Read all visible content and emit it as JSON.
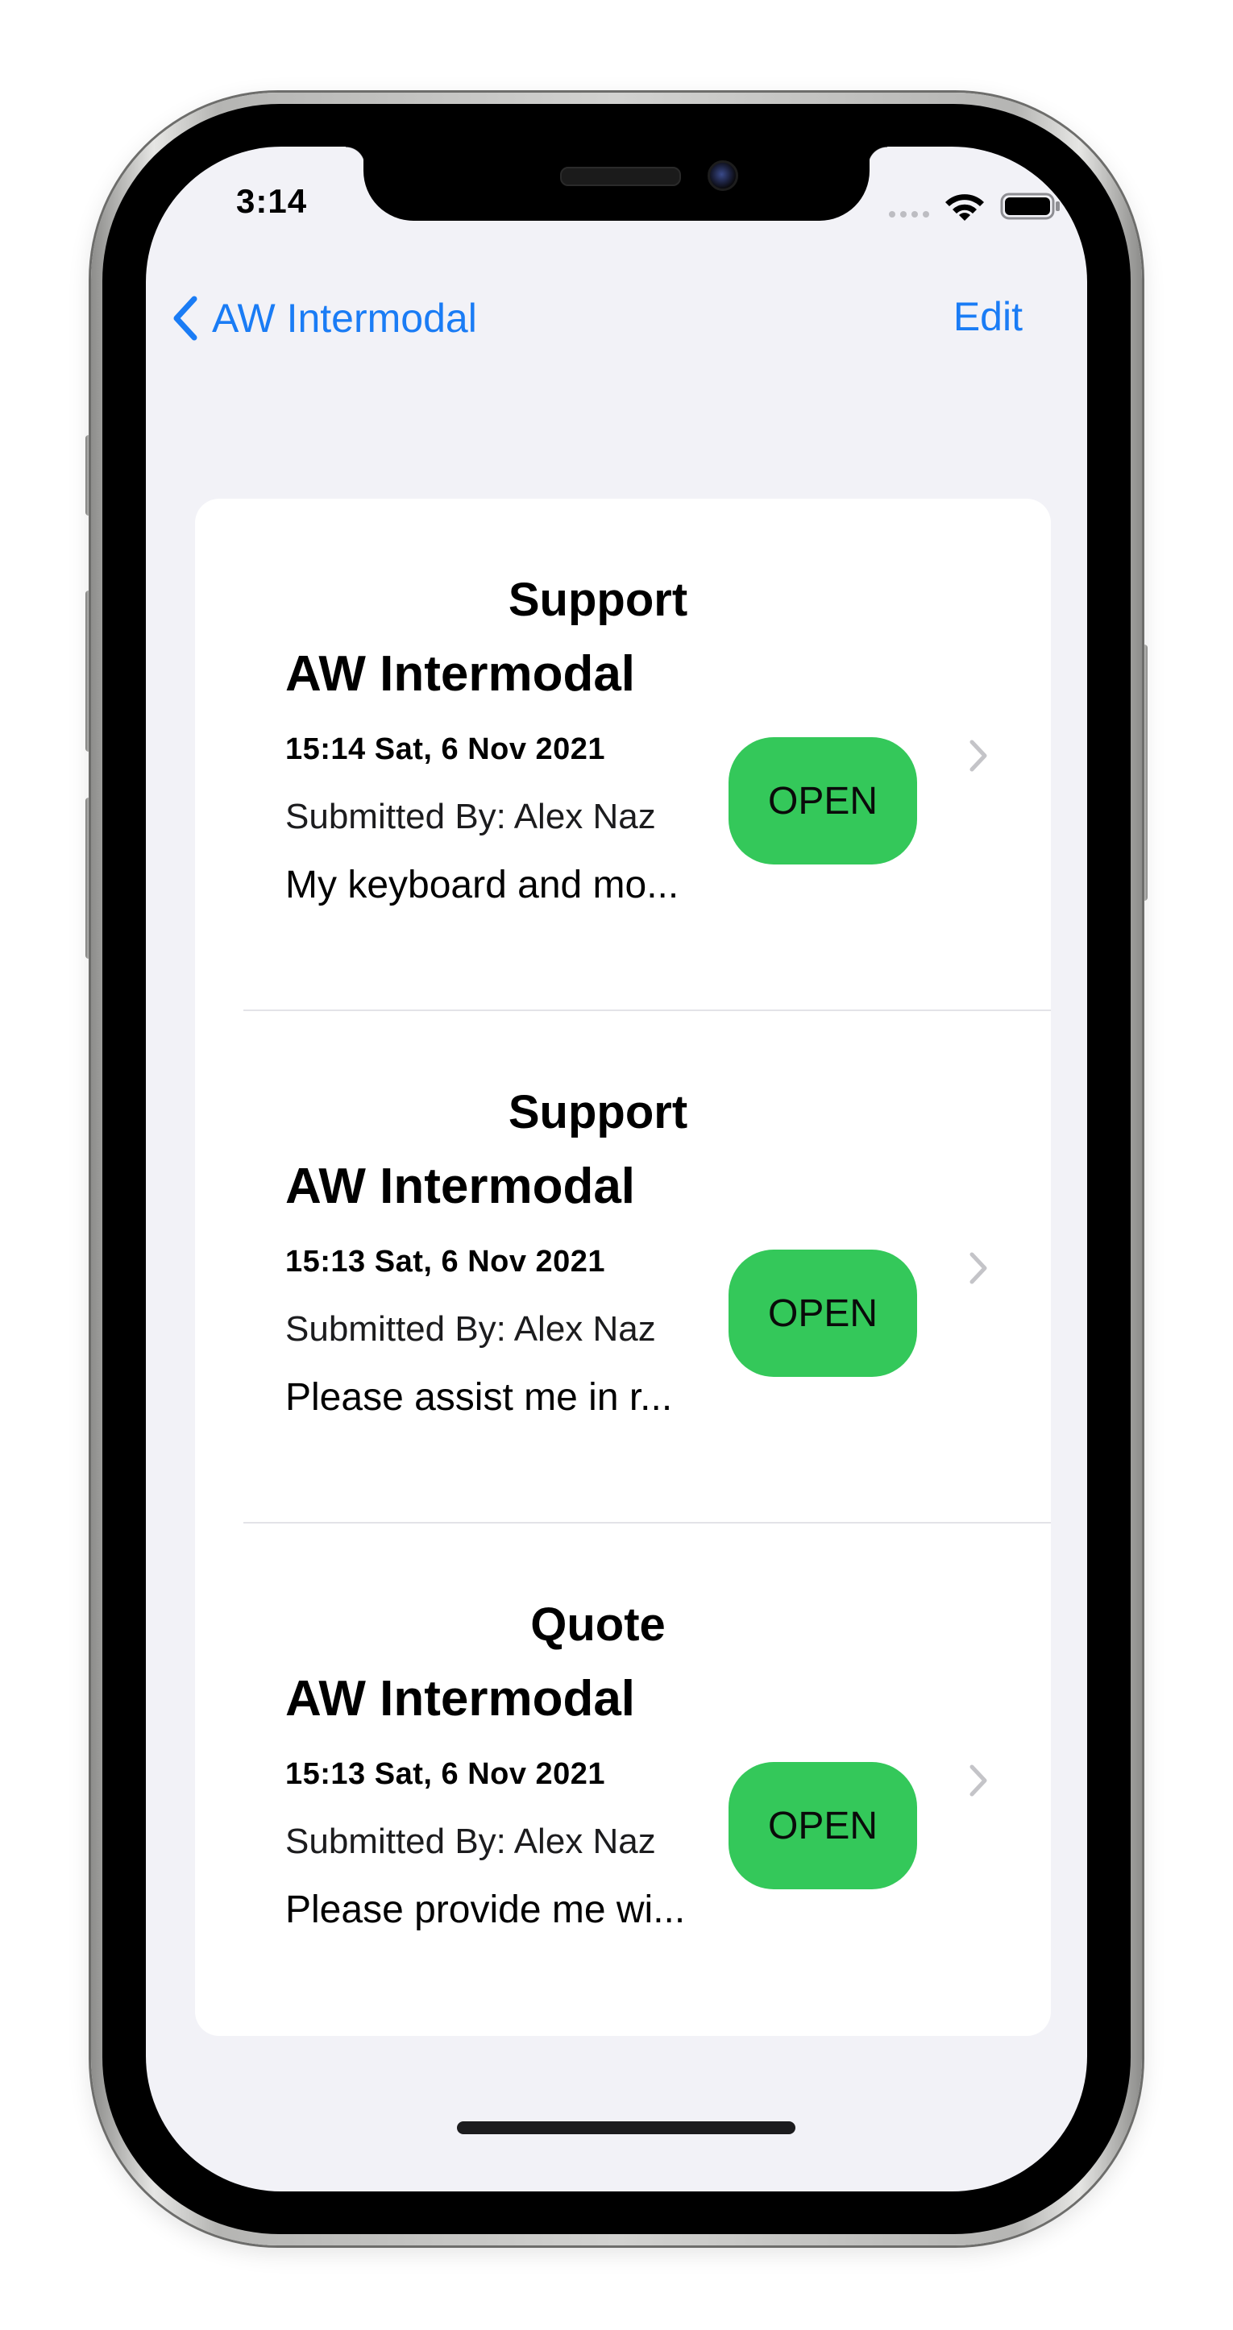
{
  "status_bar": {
    "time": "3:14"
  },
  "nav": {
    "back_label": "AW Intermodal",
    "edit_label": "Edit"
  },
  "tickets": [
    {
      "category": "Support",
      "company": "AW Intermodal",
      "datetime": "15:14 Sat, 6 Nov 2021",
      "submitter": "Submitted By: Alex Naz",
      "description": "My keyboard and mo...",
      "status": "OPEN"
    },
    {
      "category": "Support",
      "company": "AW Intermodal",
      "datetime": "15:13 Sat, 6 Nov 2021",
      "submitter": "Submitted By: Alex Naz",
      "description": "Please assist me in r...",
      "status": "OPEN"
    },
    {
      "category": "Quote",
      "company": "AW Intermodal",
      "datetime": "15:13 Sat, 6 Nov 2021",
      "submitter": "Submitted By: Alex Naz",
      "description": "Please provide me wi...",
      "status": "OPEN"
    }
  ],
  "colors": {
    "accent": "#1a7cf5",
    "status_open": "#34c85a",
    "background": "#f2f2f7"
  },
  "icons": [
    "back-chevron-icon",
    "wifi-icon",
    "battery-icon",
    "chevron-right-icon"
  ]
}
